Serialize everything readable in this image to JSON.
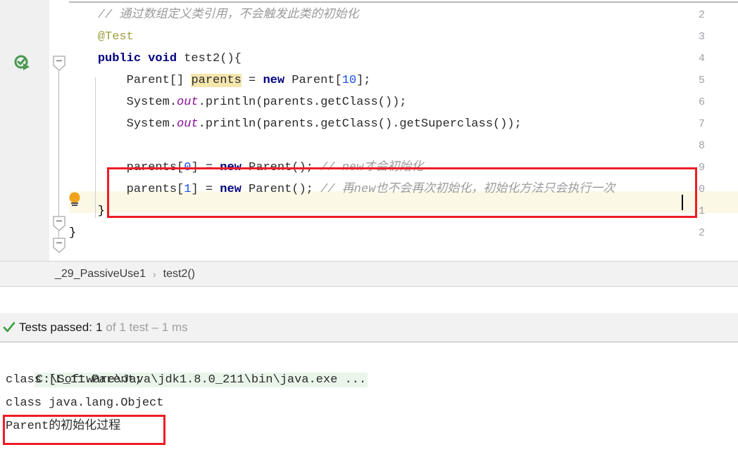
{
  "editor": {
    "line_numbers": [
      "2",
      "3",
      "4",
      "5",
      "6",
      "7",
      "8",
      "9",
      "0",
      "1",
      "2"
    ],
    "lines": [
      {
        "n": "2",
        "segments": [
          {
            "text": "    // 通过数组定义类引用，不会触发此类的初始化",
            "cls": "cmt"
          }
        ]
      },
      {
        "n": "3",
        "segments": [
          {
            "text": "    @Test",
            "cls": "anno"
          }
        ]
      },
      {
        "n": "4",
        "segments": [
          {
            "text": "    ",
            "cls": "plain"
          },
          {
            "text": "public void",
            "cls": "kw"
          },
          {
            "text": " test2(){",
            "cls": "plain"
          }
        ]
      },
      {
        "n": "5",
        "segments": [
          {
            "text": "        Parent[] ",
            "cls": "plain"
          },
          {
            "text": "parents",
            "cls": "hl-ident"
          },
          {
            "text": " = ",
            "cls": "plain"
          },
          {
            "text": "new",
            "cls": "kw"
          },
          {
            "text": " Parent[",
            "cls": "plain"
          },
          {
            "text": "10",
            "cls": "num"
          },
          {
            "text": "];",
            "cls": "plain"
          }
        ]
      },
      {
        "n": "6",
        "segments": [
          {
            "text": "        System.",
            "cls": "plain"
          },
          {
            "text": "out",
            "cls": "statfld"
          },
          {
            "text": ".println(parents.getClass());",
            "cls": "plain"
          }
        ]
      },
      {
        "n": "7",
        "segments": [
          {
            "text": "        System.",
            "cls": "plain"
          },
          {
            "text": "out",
            "cls": "statfld"
          },
          {
            "text": ".println(parents.getClass().getSuperclass());",
            "cls": "plain"
          }
        ]
      },
      {
        "n": "8",
        "segments": []
      },
      {
        "n": "9",
        "segments": [
          {
            "text": "        parents[",
            "cls": "plain"
          },
          {
            "text": "0",
            "cls": "num"
          },
          {
            "text": "] = ",
            "cls": "plain"
          },
          {
            "text": "new",
            "cls": "kw"
          },
          {
            "text": " Parent(); ",
            "cls": "plain"
          },
          {
            "text": "// new才会初始化",
            "cls": "cmt"
          }
        ]
      },
      {
        "n": "0",
        "segments": [
          {
            "text": "        parents[",
            "cls": "plain"
          },
          {
            "text": "1",
            "cls": "num"
          },
          {
            "text": "] = ",
            "cls": "plain"
          },
          {
            "text": "new",
            "cls": "kw"
          },
          {
            "text": " Parent(); ",
            "cls": "plain"
          },
          {
            "text": "// 再new也不会再次初始化，初始化方法只会执行一次",
            "cls": "cmt"
          }
        ]
      },
      {
        "n": "1",
        "segments": [
          {
            "text": "    }",
            "cls": "brace-m"
          }
        ]
      },
      {
        "n": "2",
        "segments": [
          {
            "text": "}",
            "cls": "brace-m"
          }
        ]
      }
    ],
    "gutter_icons": {
      "run_test": "run-test-icon",
      "intention_bulb": "lightbulb-icon",
      "fold": "fold-minus-icon"
    },
    "annotation_box_color": "#ee1c25"
  },
  "breadcrumb": {
    "class_name": "_29_PassiveUse1",
    "separator": "›",
    "method_name": "test2()"
  },
  "test_status": {
    "icon": "green-check-icon",
    "label": "Tests passed:",
    "count": "1",
    "detail": "of 1 test – 1 ms"
  },
  "console": {
    "command_line": "C:\\Software\\Java\\jdk1.8.0_211\\bin\\java.exe ...",
    "output_lines": [
      "class [L_11.Parent;",
      "class java.lang.Object",
      "Parent的初始化过程"
    ],
    "highlight_bg": "#e9f5e9"
  }
}
